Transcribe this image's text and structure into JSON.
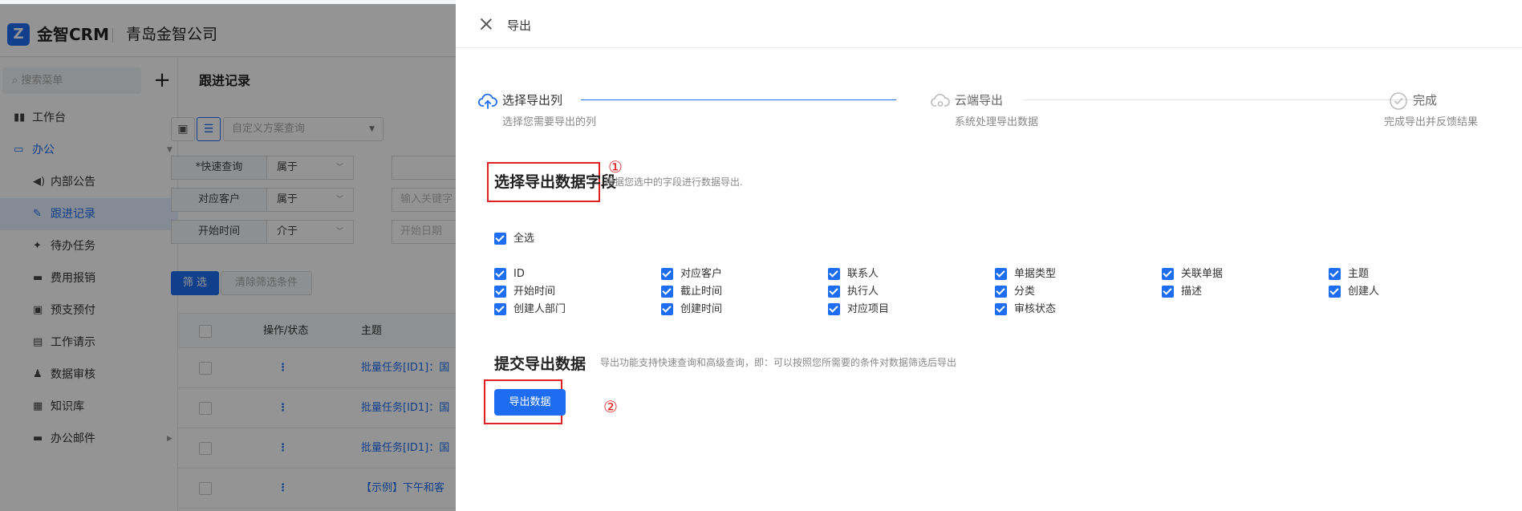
{
  "app": {
    "brand": "金智CRM",
    "company": "青岛金智公司",
    "logo_glyph": "Z"
  },
  "sidebar": {
    "search_placeholder": "搜索菜单",
    "plus_label": "+",
    "items": [
      {
        "label": "工作台",
        "icon": "▮▮",
        "level": "top"
      },
      {
        "label": "办公",
        "icon": "▭",
        "level": "group"
      },
      {
        "label": "内部公告",
        "icon": "◀)",
        "level": "sub"
      },
      {
        "label": "跟进记录",
        "icon": "✎",
        "level": "sub",
        "active": true
      },
      {
        "label": "待办任务",
        "icon": "✦",
        "level": "sub"
      },
      {
        "label": "费用报销",
        "icon": "▬",
        "level": "sub"
      },
      {
        "label": "预支预付",
        "icon": "▣",
        "level": "sub"
      },
      {
        "label": "工作请示",
        "icon": "▤",
        "level": "sub"
      },
      {
        "label": "数据审核",
        "icon": "♟",
        "level": "sub"
      },
      {
        "label": "知识库",
        "icon": "▦",
        "level": "sub"
      },
      {
        "label": "办公邮件",
        "icon": "▬",
        "level": "sub"
      }
    ]
  },
  "main": {
    "page_title": "跟进记录",
    "plan_placeholder": "自定义方案查询",
    "filters": [
      {
        "label": "*快速查询",
        "op": "属于",
        "value": ""
      },
      {
        "label": "对应客户",
        "op": "属于",
        "value": "输入关键字"
      },
      {
        "label": "开始时间",
        "op": "介于",
        "value": "开始日期"
      }
    ],
    "filter_button": "筛 选",
    "clear_button": "清除筛选条件",
    "table_headers": {
      "op_status": "操作/状态",
      "subject": "主题"
    },
    "rows": [
      {
        "dots": "⋮",
        "subject": "批量任务[ID1]：国"
      },
      {
        "dots": "⋮",
        "subject": "批量任务[ID1]：国"
      },
      {
        "dots": "⋮",
        "subject": "批量任务[ID1]：国"
      },
      {
        "dots": "⋮",
        "subject": "【示例】下午和客"
      }
    ]
  },
  "drawer": {
    "title": "导出",
    "steps": [
      {
        "title": "选择导出列",
        "desc": "选择您需要导出的列",
        "state": "active"
      },
      {
        "title": "云端导出",
        "desc": "系统处理导出数据",
        "state": "pending"
      },
      {
        "title": "完成",
        "desc": "完成导出并反馈结果",
        "state": "pending"
      }
    ],
    "section1_title": "选择导出数据字段",
    "section1_hint": "根据您选中的字段进行数据导出.",
    "select_all": "全选",
    "fields": [
      [
        "ID",
        "对应客户",
        "联系人",
        "单据类型",
        "关联单据",
        "主题"
      ],
      [
        "开始时间",
        "截止时间",
        "执行人",
        "分类",
        "描述",
        "创建人"
      ],
      [
        "创建人部门",
        "创建时间",
        "对应项目",
        "审核状态"
      ]
    ],
    "section2_title": "提交导出数据",
    "section2_hint": "导出功能支持快速查询和高级查询，即：可以按照您所需要的条件对数据筛选后导出",
    "export_button": "导出数据",
    "annotation_1": "①",
    "annotation_2": "②"
  },
  "colors": {
    "primary": "#1e6df0",
    "annotation_red": "#e02020",
    "overlay": "rgba(0,0,0,0.42)"
  }
}
